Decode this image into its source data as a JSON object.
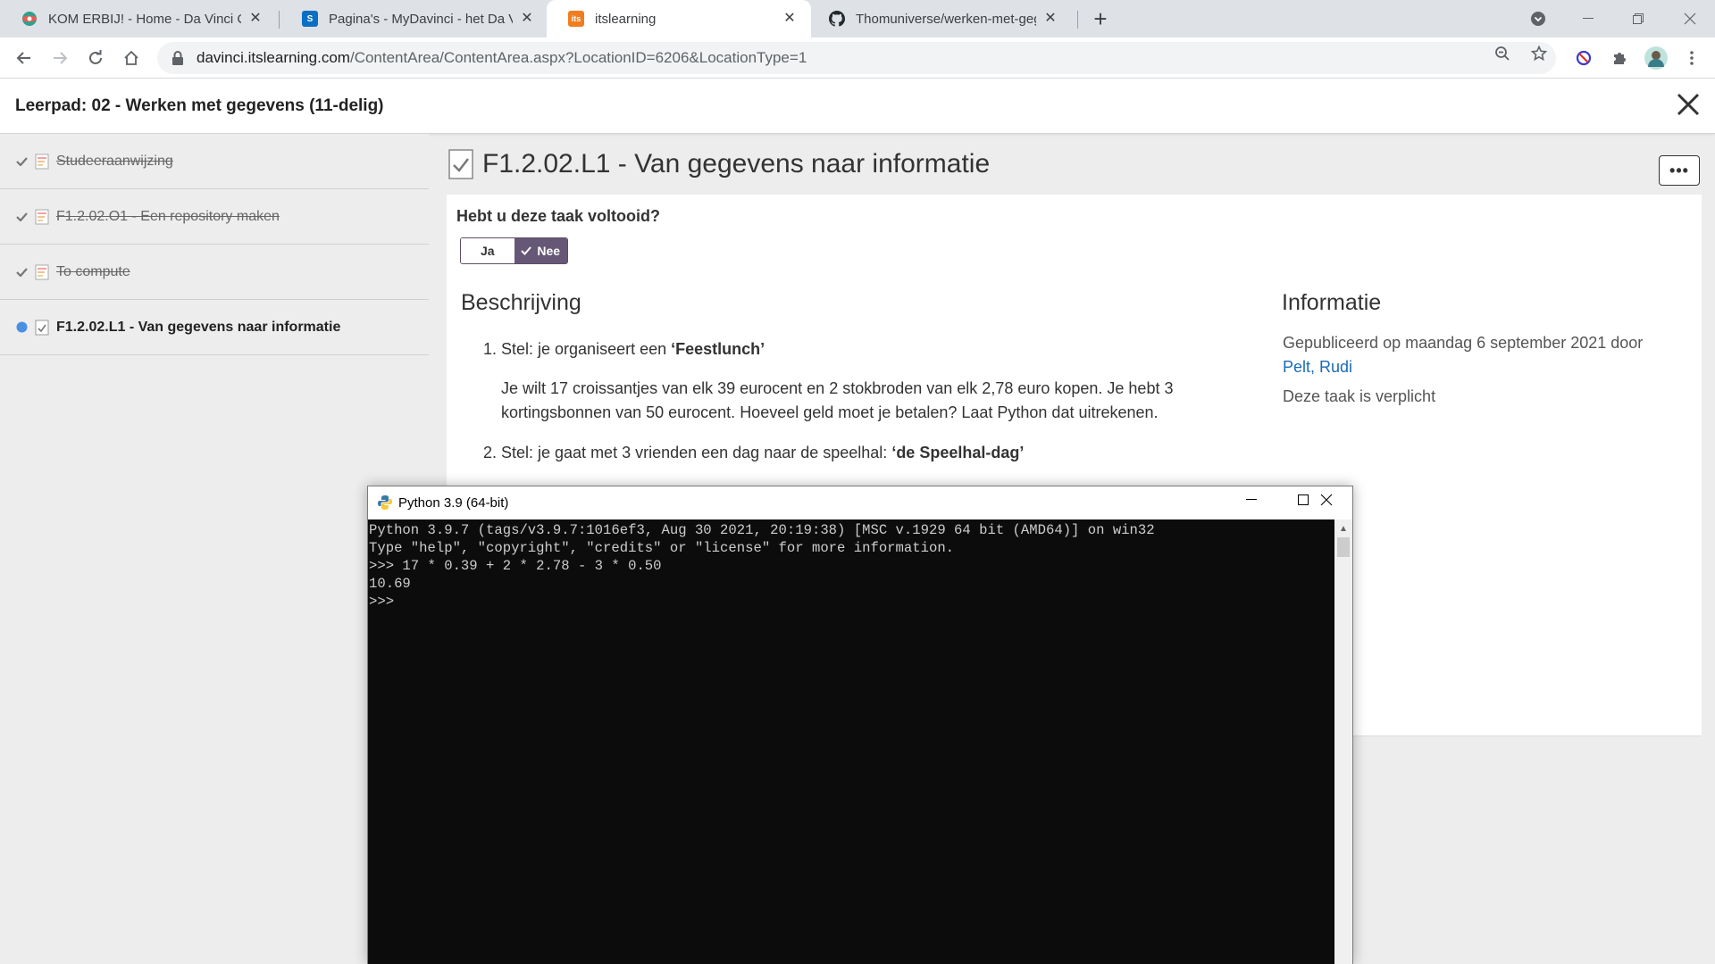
{
  "browser": {
    "tabs": [
      {
        "label": "KOM ERBIJ! - Home - Da Vinci College",
        "icon": "school-favicon-icon"
      },
      {
        "label": "Pagina's - MyDavinci - het Da Vinci intranet",
        "icon": "sharepoint-favicon-icon"
      },
      {
        "label": "itslearning",
        "icon": "itslearning-favicon-icon",
        "active": true
      },
      {
        "label": "Thomuniverse/werken-met-gegevens",
        "icon": "github-favicon-icon"
      }
    ],
    "tab_icon_text": {
      "itslearning": "its",
      "sharepoint": "S"
    },
    "url_host": "davinci.itslearning.com",
    "url_path": "/ContentArea/ContentArea.aspx?LocationID=6206&LocationType=1"
  },
  "header": {
    "title": "Leerpad: 02 - Werken met gegevens (11-delig)"
  },
  "sidebar": {
    "items": [
      {
        "label": "Studeeraanwijzing",
        "done": true
      },
      {
        "label": "F1.2.02.O1 - Een repository maken",
        "done": true
      },
      {
        "label": "To compute",
        "done": true
      },
      {
        "label": "F1.2.02.L1 - Van gegevens naar informatie",
        "current": true
      }
    ]
  },
  "main": {
    "title": "F1.2.02.L1 - Van gegevens naar informatie",
    "more_label": "•••",
    "question": "Hebt u deze taak voltooid?",
    "toggle": {
      "yes": "Ja",
      "no": "Nee",
      "selected": "no"
    },
    "description_title": "Beschrijving",
    "items": [
      {
        "num": "1.",
        "lead": "Stel: je organiseert een ",
        "bold": "‘Feestlunch’",
        "body": "Je wilt 17 croissantjes van elk 39 eurocent en 2 stokbroden van elk 2,78 euro kopen. Je hebt 3 kortingsbonnen van 50 eurocent. Hoeveel geld moet je betalen? Laat Python dat uitrekenen."
      },
      {
        "num": "2.",
        "lead": "Stel: je gaat met 3 vrienden een dag naar de speelhal: ",
        "bold": "‘de Speelhal-dag’"
      }
    ],
    "info_title": "Informatie",
    "published": "Gepubliceerd op maandag 6 september 2021 door",
    "author": "Pelt, Rudi",
    "mandatory": "Deze taak is verplicht"
  },
  "python_window": {
    "title": "Python 3.9 (64-bit)",
    "lines": [
      "Python 3.9.7 (tags/v3.9.7:1016ef3, Aug 30 2021, 20:19:38) [MSC v.1929 64 bit (AMD64)] on win32",
      "Type \"help\", \"copyright\", \"credits\" or \"license\" for more information.",
      ">>> 17 * 0.39 + 2 * 2.78 - 3 * 0.50",
      "10.69",
      ">>> "
    ]
  },
  "colors": {
    "toggle_selected": "#665776",
    "link": "#1a6bb5",
    "current_dot": "#4a90e2",
    "console_bg": "#0c0c0c"
  }
}
